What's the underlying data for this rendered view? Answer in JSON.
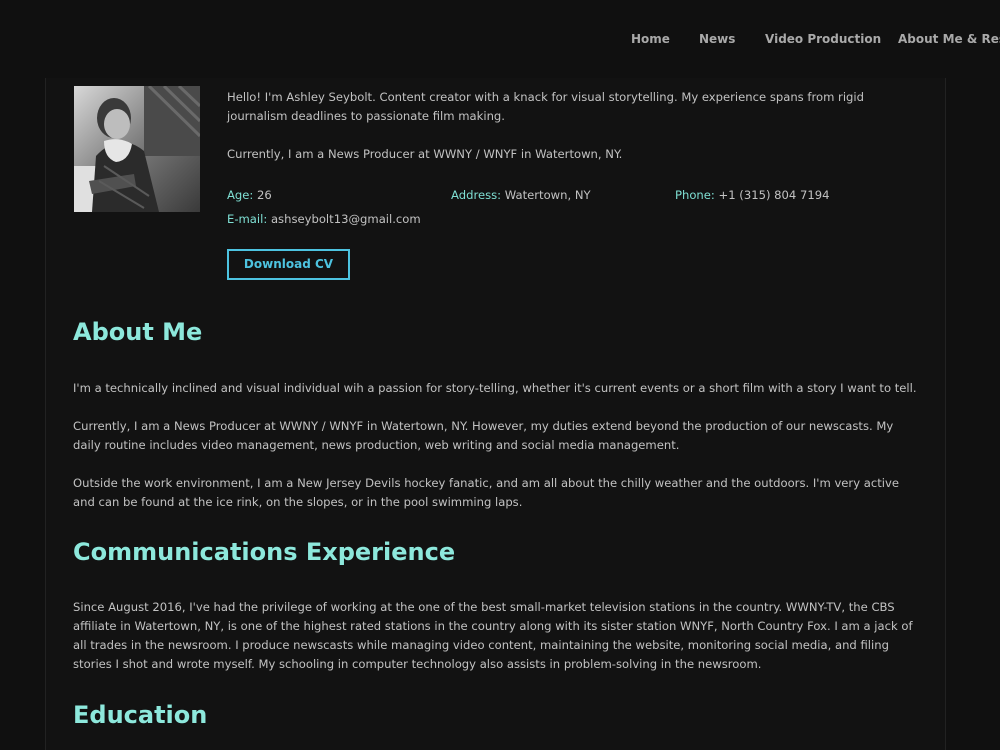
{
  "nav": {
    "items": [
      "Home",
      "News",
      "Video Production",
      "About Me & Resume"
    ]
  },
  "profile": {
    "photo_alt": "Portrait of Ashley Seybolt",
    "intro": "Hello! I'm Ashley Seybolt. Content creator with a knack for visual storytelling. My experience spans from rigid journalism deadlines to passionate film making.",
    "current": "Currently, I am a News Producer at WWNY / WNYF in Watertown, NY.",
    "age_label": "Age:",
    "age_value": " 26",
    "address_label": "Address:",
    "address_value": " Watertown, NY",
    "phone_label": "Phone:",
    "phone_value": " +1 (315) 804 7194",
    "email_label": "E-mail:",
    "email_value": " ashseybolt13@gmail.com",
    "cv_button": "Download CV"
  },
  "about": {
    "title": "About Me",
    "paragraphs": [
      "I'm a technically inclined and visual individual wih a passion for story-telling, whether it's current events or a short film with a story I want to tell.",
      "Currently, I am a News Producer at WWNY / WNYF in Watertown, NY. However, my duties extend beyond the production of our newscasts. My daily routine includes video management, news production, web writing and social media management.",
      "Outside the work environment, I am a New Jersey Devils hockey fanatic, and am all about the chilly weather and the outdoors. I'm very active and can be found at the ice rink, on the slopes, or in the pool swimming laps."
    ]
  },
  "communications": {
    "title": "Communications Experience",
    "paragraph": "Since August 2016, I've had the privilege of working at the one of the best small-market television stations in the country. WWNY-TV, the CBS affiliate in Watertown, NY, is one of the highest rated stations in the country along with its sister station WNYF, North Country Fox. I am a jack of all trades in the newsroom. I produce newscasts while managing video content, maintaining the website, monitoring social media, and filing stories I shot and wrote myself. My schooling in computer technology also assists in problem-solving in the newsroom."
  },
  "education": {
    "title": "Education"
  },
  "colors": {
    "accent": "#8de8dc",
    "button": "#4dc3e0",
    "background": "#101010"
  }
}
